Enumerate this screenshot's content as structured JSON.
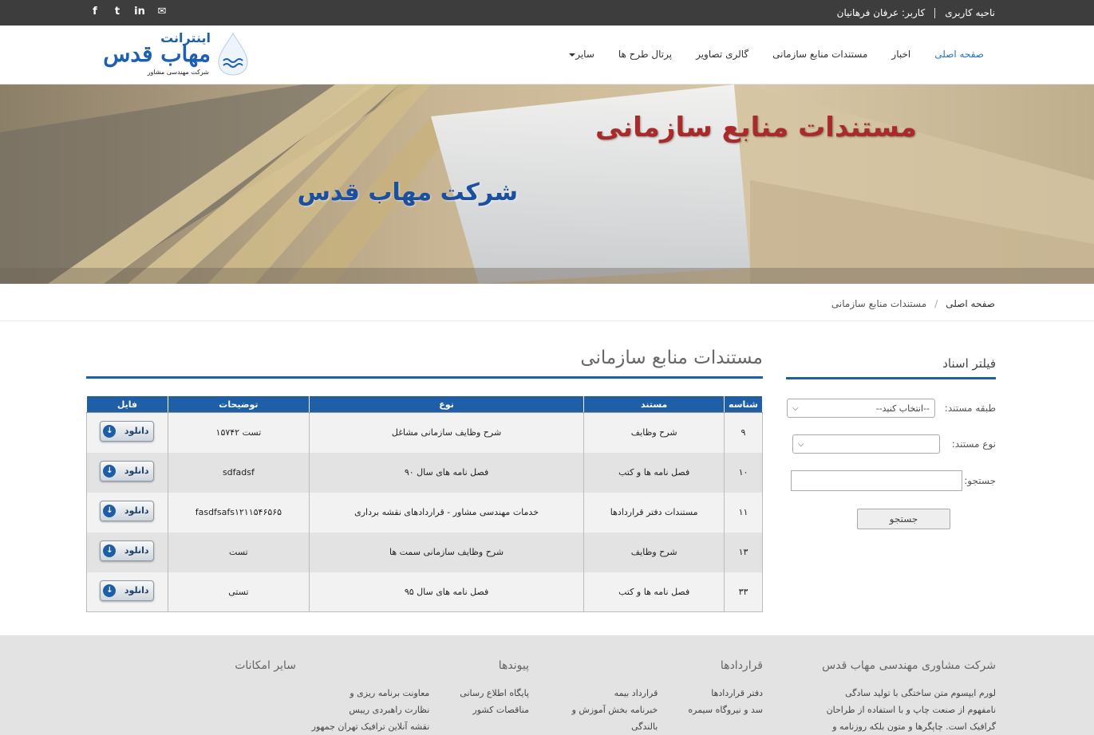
{
  "topbar": {
    "user_area_label": "ناحیه کاربری",
    "user_label": "کاربر: عرفان فرهانیان",
    "social_icons": [
      "facebook-icon",
      "twitter-icon",
      "linkedin-icon",
      "email-icon"
    ],
    "social_glyphs": {
      "facebook": "f",
      "twitter": "t",
      "linkedin": "in",
      "email": "✉"
    }
  },
  "logo": {
    "title": "اینترانت",
    "main": "مهاب قدس",
    "sub": "شرکت مهندسی مشاور"
  },
  "nav": {
    "items": [
      "صفحه اصلی",
      "اخبار",
      "مستندات منابع سازمانی",
      "گالری تصاویر",
      "پرتال طرح ها",
      "سایر"
    ],
    "active_color": "#2a73bf"
  },
  "banner": {
    "title": "مستندات منابع سازمانی",
    "subtitle": "شرکت مهاب قدس"
  },
  "breadcrumb": {
    "home": "صفحه اصلی",
    "separator": "/",
    "current": "مستندات منابع سازمانی"
  },
  "filter": {
    "title": "فیلتر اسناد",
    "category_label": "طبقه مستند:",
    "category_value": "--انتخاب کنید--",
    "type_label": "نوع مستند:",
    "type_value": "",
    "search_label": "جستجو:",
    "search_value": "",
    "search_button": "جستجو"
  },
  "main": {
    "title": "مستندات منابع سازمانی"
  },
  "table": {
    "headers": [
      "شناسه",
      "مستند",
      "نوع",
      "توضیحات",
      "فایل"
    ],
    "download_label": "دانلود",
    "download_arrow": "↓",
    "rows": [
      {
        "id": "۹",
        "doc": "شرح وظایف",
        "type": "شرح وظایف سازمانی مشاغل",
        "desc": "تست ۱۵۷۴۲"
      },
      {
        "id": "۱۰",
        "doc": "فصل نامه ها و کتب",
        "type": "فصل نامه های سال ۹۰",
        "desc": "sdfadsf"
      },
      {
        "id": "۱۱",
        "doc": "مستندات دفتر قراردادها",
        "type": "خدمات مهندسی مشاور - قراردادهای نقشه برداری",
        "desc": "fasdfsafs۱۲۱۱۵۴۶۵۶۵"
      },
      {
        "id": "۱۳",
        "doc": "شرح وظایف",
        "type": "شرح وظایف سازمانی سمت ها",
        "desc": "تست"
      },
      {
        "id": "۳۳",
        "doc": "فصل نامه ها و کتب",
        "type": "فصل نامه های سال ۹۵",
        "desc": "تستی"
      }
    ]
  },
  "footer": {
    "about": {
      "title": "شرکت مشاوری مهندسی مهاب قدس",
      "text": "لورم ایپسوم متن ساختگی با تولید سادگی نامفهوم از صنعت چاپ و با استفاده از طراحان گرافیک است. چاپگرها و متون بلکه روزنامه و مجله در ستون و"
    },
    "contracts": {
      "title": "قراردادها",
      "items": [
        "دفتر قراردادها",
        "قرارداد بیمه",
        "سد و نیروگاه سیمره",
        "خبرنامه بخش آموزش و",
        "بالندگی"
      ]
    },
    "links": {
      "title": "پیوندها",
      "items": [
        "پایگاه اطلاع رسانی",
        "معاونت برنامه ریزی و",
        "مناقصات کشور",
        "نظارت راهبردی رییس",
        "نقشه آنلاین ترافیک تهران جمهور"
      ]
    },
    "other": {
      "title": "سایر امکانات"
    }
  }
}
